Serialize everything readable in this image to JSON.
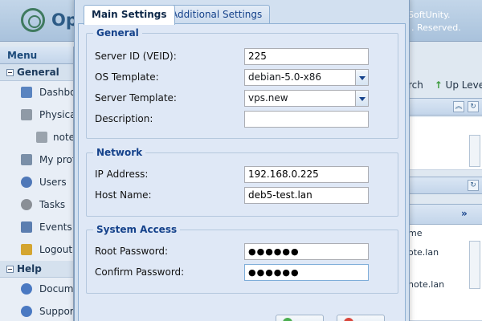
{
  "app": {
    "brand": "Op",
    "copyright_line1": "SoftUnity.",
    "copyright_line2": ". Reserved."
  },
  "sidebar": {
    "title": "Menu",
    "groups": [
      {
        "label": "General",
        "items": [
          {
            "label": "Dashbo",
            "icon": "dashboard-icon"
          },
          {
            "label": "Physical",
            "icon": "server-icon"
          },
          {
            "label": "note.",
            "icon": "node-icon",
            "sub": true
          },
          {
            "label": "My profil",
            "icon": "profile-icon"
          },
          {
            "label": "Users",
            "icon": "users-icon"
          },
          {
            "label": "Tasks",
            "icon": "gear-icon"
          },
          {
            "label": "Events lo",
            "icon": "events-log-icon"
          },
          {
            "label": "Logout",
            "icon": "logout-icon"
          }
        ]
      },
      {
        "label": "Help",
        "items": [
          {
            "label": "Documer",
            "icon": "help-icon"
          },
          {
            "label": "Support",
            "icon": "support-icon"
          }
        ]
      }
    ]
  },
  "background": {
    "toolbar_search": "rch",
    "toolbar_up_level": "Up Level",
    "grid_header": "me",
    "grid_rows": [
      "ote.lan",
      "note.lan"
    ]
  },
  "dialog": {
    "tabs": [
      {
        "label": "Main Settings",
        "active": true
      },
      {
        "label": "Additional Settings",
        "active": false
      }
    ],
    "general": {
      "legend": "General",
      "server_id_label": "Server ID (VEID):",
      "server_id_value": "225",
      "os_template_label": "OS Template:",
      "os_template_value": "debian-5.0-x86",
      "server_template_label": "Server Template:",
      "server_template_value": "vps.new",
      "description_label": "Description:",
      "description_value": ""
    },
    "network": {
      "legend": "Network",
      "ip_label": "IP Address:",
      "ip_value": "192.168.0.225",
      "host_label": "Host Name:",
      "host_value": "deb5-test.lan"
    },
    "access": {
      "legend": "System Access",
      "root_pw_label": "Root Password:",
      "root_pw_value": "●●●●●●",
      "confirm_pw_label": "Confirm Password:",
      "confirm_pw_value": "●●●●●●"
    }
  },
  "colors": {
    "accent": "#15428b",
    "panel": "#dfe8f6",
    "header_bg": "#a9c2dc"
  }
}
